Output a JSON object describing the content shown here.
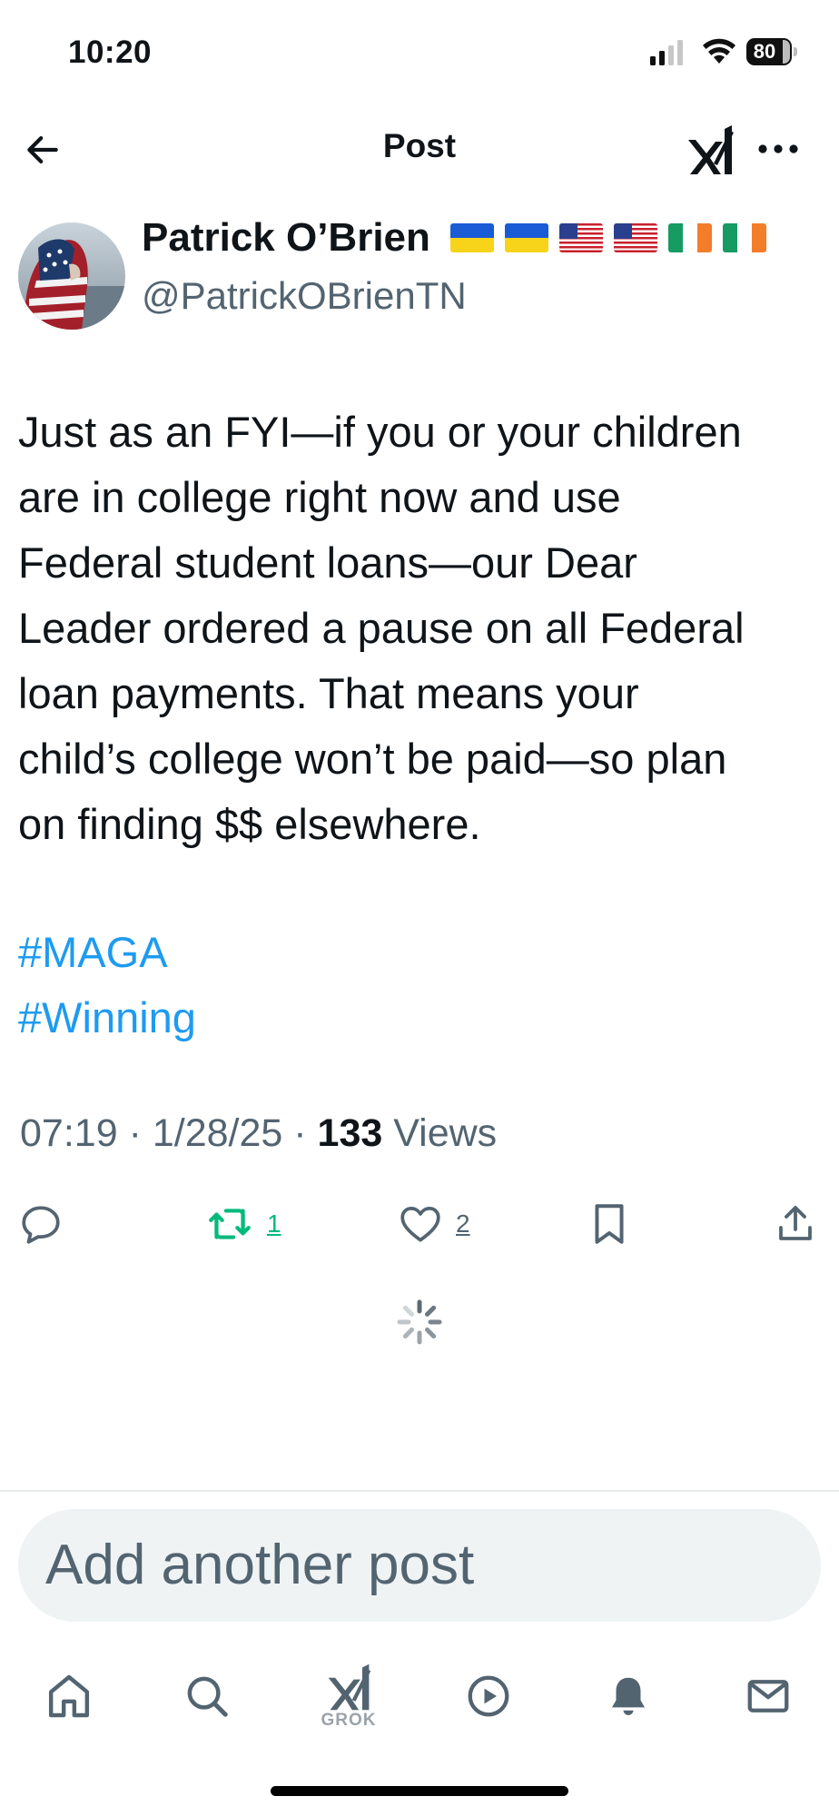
{
  "status_bar": {
    "time": "10:20",
    "battery": "80"
  },
  "header": {
    "title": "Post"
  },
  "post": {
    "author": {
      "display_name": "Patrick O’Brien",
      "handle": "@PatrickOBrienTN",
      "name_flags": [
        "ukraine-flag",
        "ukraine-flag",
        "us-flag",
        "us-flag",
        "ireland-flag",
        "ireland-flag"
      ]
    },
    "body_lines": [
      "Just as an FYI—if you or your children",
      "are in college right now and use",
      "Federal student loans—our Dear",
      "Leader ordered a pause on all Federal",
      "loan payments. That means your",
      "child’s college won’t be paid—so plan",
      "on finding $$ elsewhere."
    ],
    "hashtags": [
      "#MAGA",
      "#Winning"
    ],
    "time": "07:19",
    "date": "1/28/25",
    "separator": "·",
    "views_count": "133",
    "views_label": "Views",
    "reposts": "1",
    "likes": "2"
  },
  "compose": {
    "placeholder": "Add another post"
  },
  "tab_bar": {
    "grok_label": "GROK"
  },
  "colors": {
    "accent_blue": "#1d9bf0",
    "repost_green": "#00ba7c",
    "secondary_text": "#536471",
    "primary_text": "#0f1419"
  },
  "icons": {
    "back": "arrow-left-icon",
    "grok": "grok-icon",
    "more": "more-horizontal-icon",
    "reply": "reply-icon",
    "repost": "repost-icon",
    "like": "heart-icon",
    "bookmark": "bookmark-icon",
    "share": "share-icon",
    "home": "home-icon",
    "search": "search-icon",
    "video": "play-icon",
    "notifications": "bell-icon",
    "messages": "mail-icon"
  }
}
